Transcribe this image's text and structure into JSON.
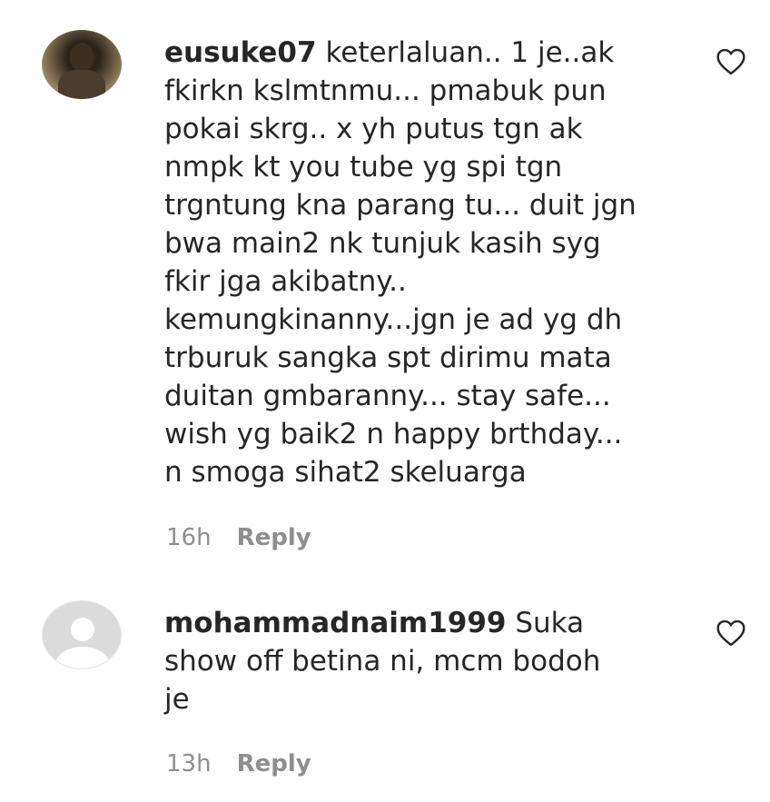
{
  "comments": [
    {
      "username": "eusuke07",
      "text": "keterlaluan.. 1 je..ak\nfkirkn kslmtnmu... pmabuk pun\npokai skrg.. x yh putus tgn ak\nnmpk kt you tube yg spi tgn\ntrgntung kna parang tu... duit jgn\nbwa main2 nk tunjuk kasih syg\nfkir jga akibatny..\nkemungkinanny...jgn je ad yg dh\ntrburuk sangka spt dirimu mata\nduitan gmbaranny... stay safe...\nwish yg baik2 n happy brthday...\nn smoga sihat2 skeluarga",
      "time": "16h",
      "reply_label": "Reply",
      "avatar": "user-photo",
      "like_icon": "heart-outline-icon"
    },
    {
      "username": "mohammadnaim1999",
      "text": "Suka\nshow off betina ni, mcm bodoh\nje",
      "time": "13h",
      "reply_label": "Reply",
      "avatar": "default-avatar",
      "like_icon": "heart-outline-icon"
    }
  ]
}
